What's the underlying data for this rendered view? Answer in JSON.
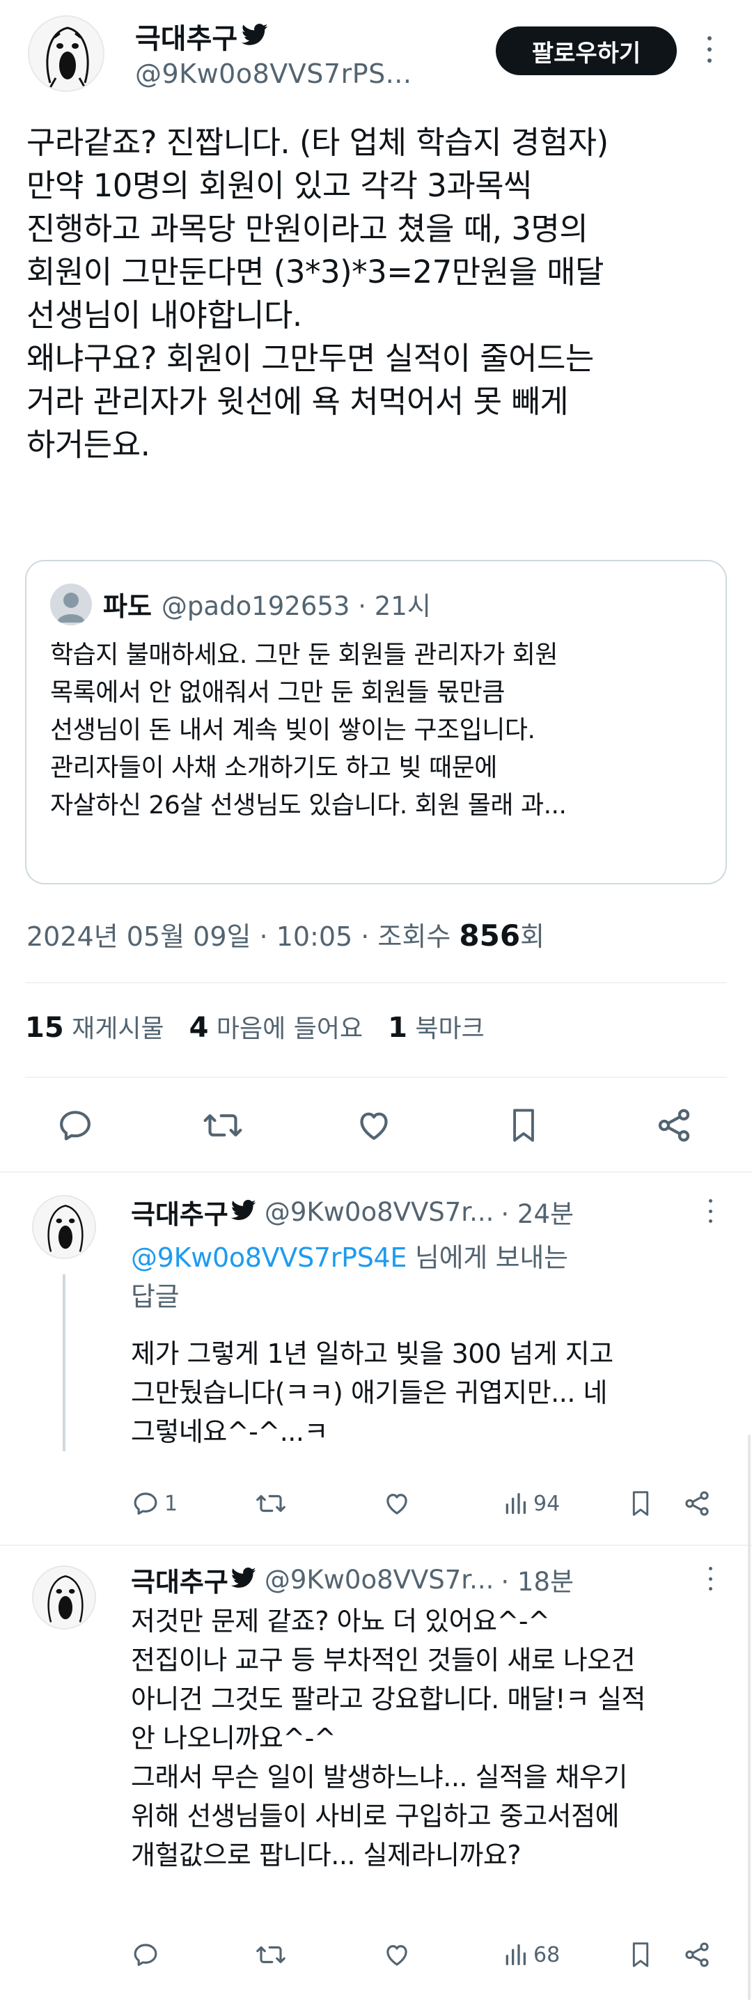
{
  "main_tweet": {
    "display_name": "극대추구",
    "handle": "@9Kw0o8VVS7rPS...",
    "follow_label": "팔로우하기",
    "text": "구라같죠? 진짭니다. (타 업체 학습지 경험자)\n만약 10명의 회원이 있고 각각 3과목씩\n진행하고 과목당 만원이라고 쳤을 때, 3명의\n회원이 그만둔다면 (3*3)*3=27만원을 매달\n선생님이 내야합니다.\n왜냐구요? 회원이 그만두면 실적이 줄어드는\n거라 관리자가 윗선에 욕 처먹어서 못 빼게\n하거든요.",
    "quote": {
      "name": "파도",
      "handle_time": "@pado192653 · 21시",
      "text": "학습지 불매하세요. 그만 둔 회원들 관리자가 회원\n목록에서 안 없애줘서 그만 둔 회원들 몫만큼\n선생님이 돈 내서 계속 빚이 쌓이는 구조입니다.\n관리자들이 사채 소개하기도 하고 빚 때문에\n자살하신 26살 선생님도 있습니다. 회원 몰래 과..."
    },
    "meta": {
      "datetime": "2024년 05월 09일 · 10:05 · 조회수 ",
      "views": "856",
      "views_suffix": "회"
    },
    "stats": {
      "retweets_num": "15",
      "retweets_label": "재게시물",
      "likes_num": "4",
      "likes_label": "마음에 들어요",
      "bookmarks_num": "1",
      "bookmarks_label": "북마크"
    }
  },
  "replies": [
    {
      "display_name": "극대추구",
      "handle": "@9Kw0o8VVS7r...",
      "time": "· 24분",
      "reply_to_handle": "@9Kw0o8VVS7rPS4E",
      "reply_to_suffix": " 님에게 보내는",
      "reply_to_line2": "답글",
      "text": "제가 그렇게 1년 일하고 빚을 300 넘게 지고\n그만뒀습니다(ㅋㅋ) 애기들은 귀엽지만... 네\n그렇네요^-^...ㅋ",
      "reply_count": "1",
      "views": "94"
    },
    {
      "display_name": "극대추구",
      "handle": "@9Kw0o8VVS7r...",
      "time": "· 18분",
      "text": "저것만 문제 같죠? 아뇨 더 있어요^-^\n전집이나 교구 등 부차적인 것들이 새로 나오건\n아니건 그것도 팔라고 강요합니다. 매달!ㅋ 실적\n안 나오니까요^-^\n그래서 무슨 일이 발생하느냐... 실적을 채우기\n위해 선생님들이 사비로 구입하고 중고서점에\n개헐값으로 팝니다... 실제라니까요?",
      "views": "68"
    }
  ],
  "colors": {
    "text": "#0f1419",
    "secondary": "#536471",
    "link": "#1d9bf0",
    "border": "#cfd9de"
  },
  "icons": [
    "verified-bird-icon",
    "more-dots-icon",
    "reply-icon",
    "retweet-icon",
    "like-icon",
    "bookmark-icon",
    "share-icon",
    "views-chart-icon"
  ]
}
